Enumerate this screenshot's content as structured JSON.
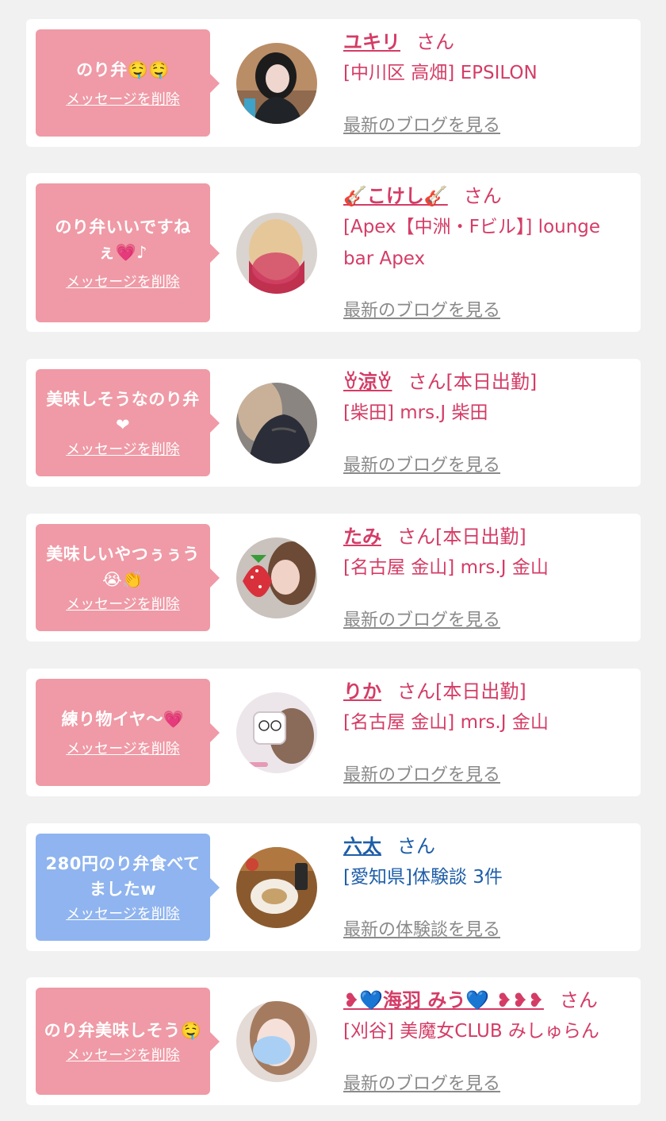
{
  "items": [
    {
      "message": "のり弁🤤🤤",
      "delete_label": "メッセージを削除",
      "name": "ユキリ",
      "suffix": "さん",
      "shop": "[中川区 高畑] EPSILON",
      "blog_label": "最新のブログを見る",
      "theme": "pink"
    },
    {
      "message": "のり弁いいですねぇ💗♪",
      "delete_label": "メッセージを削除",
      "name": "🎸こけし🎸",
      "suffix": "さん",
      "shop": "[Apex【中洲・Fビル】] lounge bar Apex",
      "blog_label": "最新のブログを見る",
      "theme": "pink"
    },
    {
      "message": "美味しそうなのり弁❤",
      "delete_label": "メッセージを削除",
      "name": "ꈊ涼ꈊ",
      "suffix": "さん[本日出勤]",
      "shop": "[柴田] mrs.J 柴田",
      "blog_label": "最新のブログを見る",
      "theme": "pink"
    },
    {
      "message": "美味しいやつぅぅう😭👏",
      "delete_label": "メッセージを削除",
      "name": "たみ",
      "suffix": "さん[本日出勤]",
      "shop": "[名古屋 金山] mrs.J 金山",
      "blog_label": "最新のブログを見る",
      "theme": "pink"
    },
    {
      "message": "練り物イヤ〜💗",
      "delete_label": "メッセージを削除",
      "name": "りか",
      "suffix": "さん[本日出勤]",
      "shop": "[名古屋 金山] mrs.J 金山",
      "blog_label": "最新のブログを見る",
      "theme": "pink"
    },
    {
      "message": "280円のり弁食べてましたw",
      "delete_label": "メッセージを削除",
      "name": "六太",
      "suffix": "さん",
      "shop": "[愛知県]体験談 3件",
      "blog_label": "最新の体験談を見る",
      "theme": "blue"
    },
    {
      "message": "のり弁美味しそう🤤",
      "delete_label": "メッセージを削除",
      "name": "❥💙海羽 みう💙 ❥❥❥",
      "suffix": "さん",
      "shop": "[刈谷] 美魔女CLUB みしゅらん",
      "blog_label": "最新のブログを見る",
      "theme": "pink"
    }
  ],
  "colors": {
    "pink_bubble": "#ef9aa6",
    "blue_bubble": "#8fb4ef",
    "pink_text": "#d43c66",
    "blue_text": "#1e5ea8",
    "link_gray": "#8a8a8a"
  }
}
